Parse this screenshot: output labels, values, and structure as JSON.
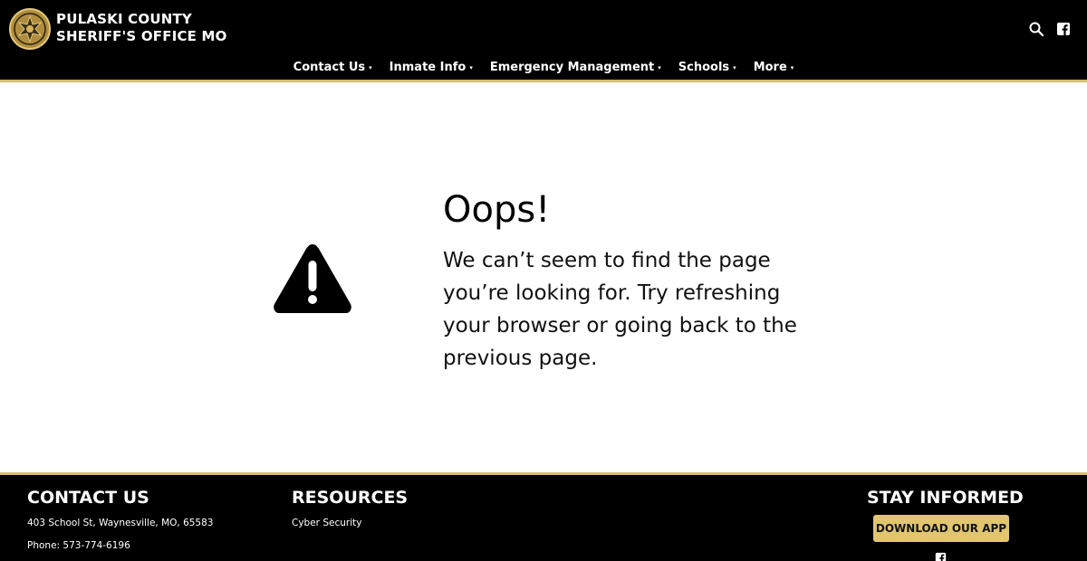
{
  "header": {
    "title_line1": "PULASKI COUNTY",
    "title_line2": "SHERIFF'S OFFICE MO",
    "logo_icon": "sheriff-star-badge",
    "icons": [
      "search-icon",
      "facebook-icon"
    ]
  },
  "nav": {
    "items": [
      {
        "label": "Contact Us"
      },
      {
        "label": "Inmate Info"
      },
      {
        "label": "Emergency Management"
      },
      {
        "label": "Schools"
      },
      {
        "label": "More"
      }
    ],
    "caret": "▾"
  },
  "main": {
    "heading": "Oops!",
    "message": "We can’t seem to find the page you’re looking for. Try refreshing your browser or going back to the previous page.",
    "icon": "warning-triangle-icon"
  },
  "footer": {
    "contact": {
      "heading": "CONTACT US",
      "address": "403 School St, Waynesville, MO, 65583",
      "phone": "Phone: 573-774-6196"
    },
    "resources": {
      "heading": "RESOURCES",
      "links": [
        "Cyber Security"
      ]
    },
    "stay_informed": {
      "heading": "STAY INFORMED",
      "button_label": "DOWNLOAD OUR APP"
    }
  },
  "colors": {
    "background_dark": "#000000",
    "accent_gold": "#d8be6a",
    "button_gold": "#e1c56f",
    "page_background": "#ffffff"
  }
}
